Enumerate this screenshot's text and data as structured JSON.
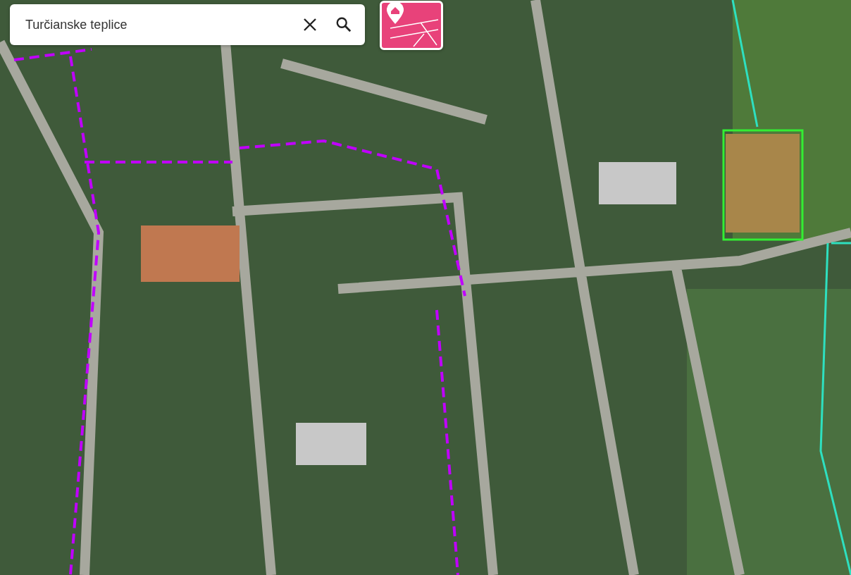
{
  "search": {
    "value": "Turčianske teplice"
  }
}
